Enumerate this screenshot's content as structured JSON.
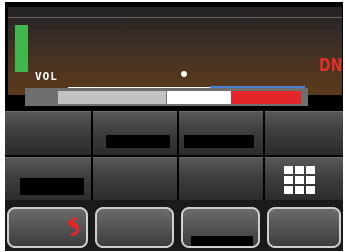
{
  "display": {
    "vol_label": "VOL",
    "mode_label": "DN",
    "volume_level": 0.52,
    "signal_level": 0.62
  },
  "icons": {
    "keypad": "grid-icon",
    "back": "back-arrow-icon"
  },
  "colors": {
    "signal": "#41b64c",
    "mode": "#e0302a",
    "meter_red": "#e4252a",
    "meter_scale": "#4a7fd8"
  }
}
